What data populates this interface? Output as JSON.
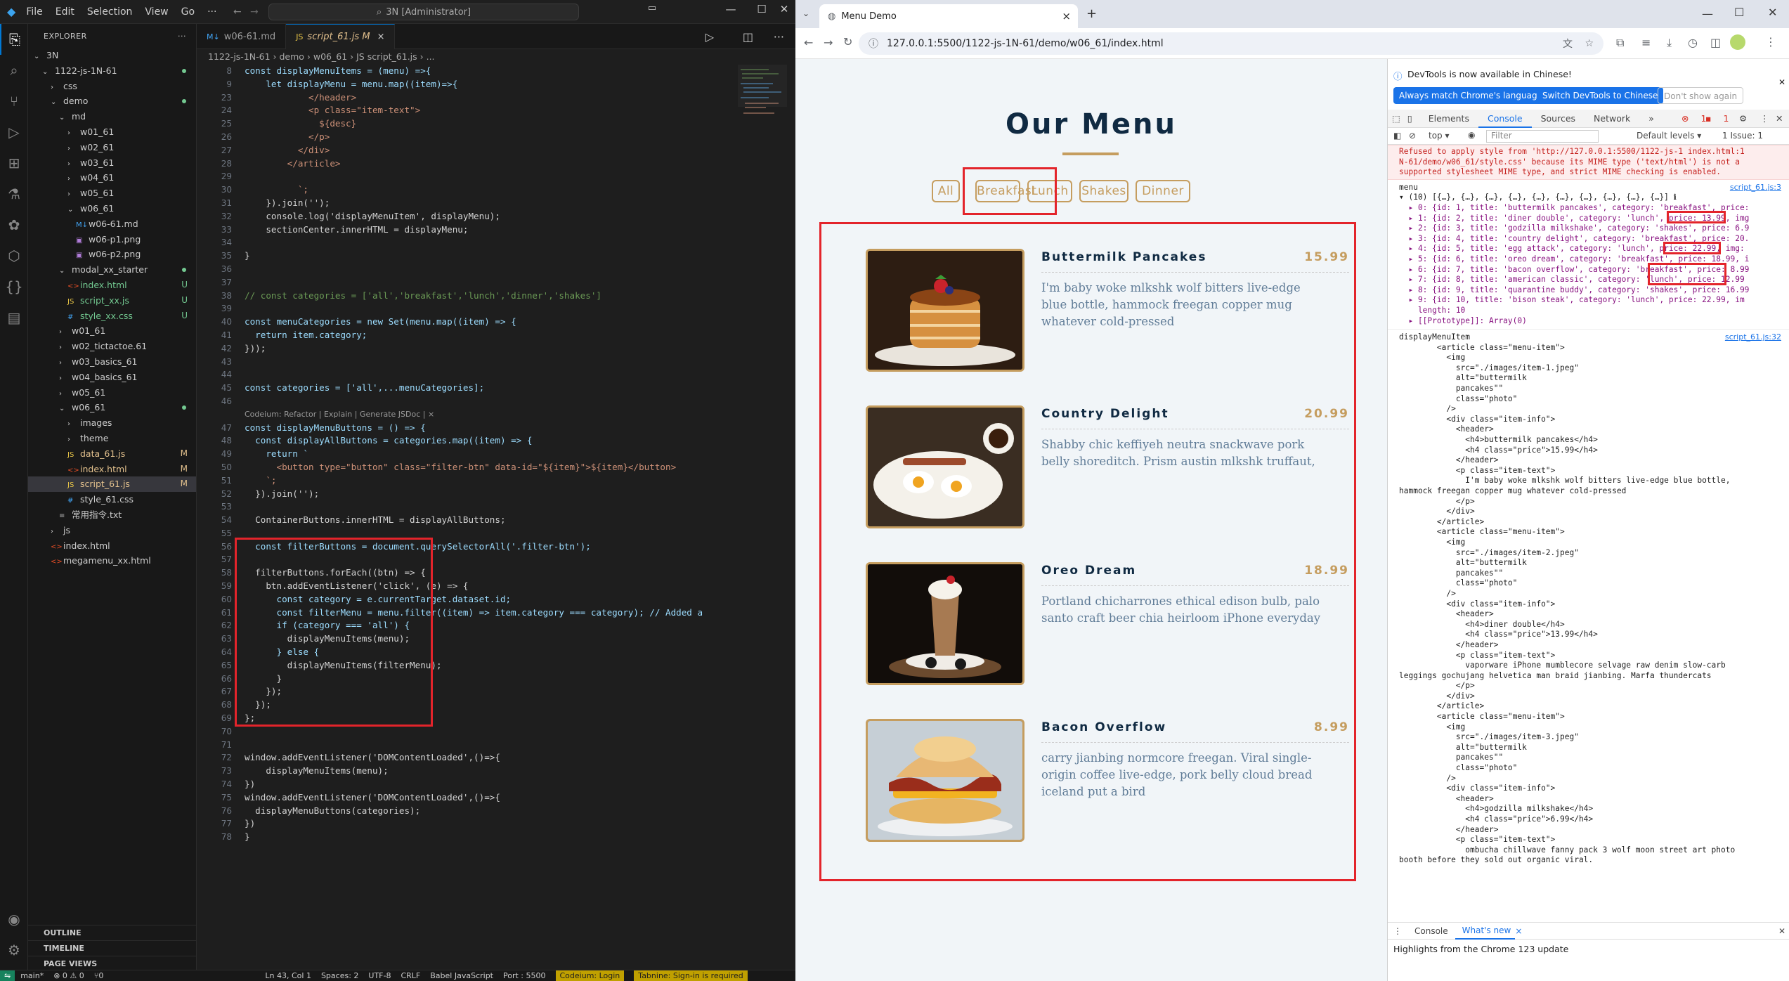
{
  "vscode": {
    "menus": [
      "File",
      "Edit",
      "Selection",
      "View",
      "Go",
      "···"
    ],
    "command_center": "3N [Administrator]",
    "explorer_title": "EXPLORER",
    "tree": [
      {
        "label": "3N",
        "indent": 0,
        "type": "folder-open",
        "status": ""
      },
      {
        "label": "1122-js-1N-61",
        "indent": 1,
        "type": "folder-open",
        "status": "dot"
      },
      {
        "label": "css",
        "indent": 2,
        "type": "folder",
        "status": ""
      },
      {
        "label": "demo",
        "indent": 2,
        "type": "folder-open",
        "status": "dot"
      },
      {
        "label": "md",
        "indent": 3,
        "type": "folder-open",
        "status": ""
      },
      {
        "label": "w01_61",
        "indent": 4,
        "type": "folder",
        "status": ""
      },
      {
        "label": "w02_61",
        "indent": 4,
        "type": "folder",
        "status": ""
      },
      {
        "label": "w03_61",
        "indent": 4,
        "type": "folder",
        "status": ""
      },
      {
        "label": "w04_61",
        "indent": 4,
        "type": "folder",
        "status": ""
      },
      {
        "label": "w05_61",
        "indent": 4,
        "type": "folder",
        "status": ""
      },
      {
        "label": "w06_61",
        "indent": 4,
        "type": "folder-open",
        "status": ""
      },
      {
        "label": "w06-61.md",
        "indent": 5,
        "type": "md",
        "status": ""
      },
      {
        "label": "w06-p1.png",
        "indent": 5,
        "type": "img",
        "status": ""
      },
      {
        "label": "w06-p2.png",
        "indent": 5,
        "type": "img",
        "status": ""
      },
      {
        "label": "modal_xx_starter",
        "indent": 3,
        "type": "folder-open",
        "status": "dot"
      },
      {
        "label": "index.html",
        "indent": 4,
        "type": "html",
        "status": "U"
      },
      {
        "label": "script_xx.js",
        "indent": 4,
        "type": "js",
        "status": "U"
      },
      {
        "label": "style_xx.css",
        "indent": 4,
        "type": "css",
        "status": "U"
      },
      {
        "label": "w01_61",
        "indent": 3,
        "type": "folder",
        "status": ""
      },
      {
        "label": "w02_tictactoe.61",
        "indent": 3,
        "type": "folder",
        "status": ""
      },
      {
        "label": "w03_basics_61",
        "indent": 3,
        "type": "folder",
        "status": ""
      },
      {
        "label": "w04_basics_61",
        "indent": 3,
        "type": "folder",
        "status": ""
      },
      {
        "label": "w05_61",
        "indent": 3,
        "type": "folder",
        "status": ""
      },
      {
        "label": "w06_61",
        "indent": 3,
        "type": "folder-open",
        "status": "dot"
      },
      {
        "label": "images",
        "indent": 4,
        "type": "folder",
        "status": ""
      },
      {
        "label": "theme",
        "indent": 4,
        "type": "folder",
        "status": ""
      },
      {
        "label": "data_61.js",
        "indent": 4,
        "type": "js",
        "status": "M"
      },
      {
        "label": "index.html",
        "indent": 4,
        "type": "html",
        "status": "M"
      },
      {
        "label": "script_61.js",
        "indent": 4,
        "type": "js",
        "status": "M",
        "selected": true
      },
      {
        "label": "style_61.css",
        "indent": 4,
        "type": "css",
        "status": ""
      },
      {
        "label": "常用指令.txt",
        "indent": 3,
        "type": "txt",
        "status": ""
      },
      {
        "label": "js",
        "indent": 2,
        "type": "folder",
        "status": ""
      },
      {
        "label": "index.html",
        "indent": 2,
        "type": "html",
        "status": ""
      },
      {
        "label": "megamenu_xx.html",
        "indent": 2,
        "type": "html",
        "status": ""
      }
    ],
    "sections": [
      "OUTLINE",
      "TIMELINE",
      "PAGE VIEWS"
    ],
    "tabs": [
      {
        "label": "w06-61.md",
        "icon": "M↓"
      },
      {
        "label": "script_61.js M",
        "icon": "JS"
      }
    ],
    "tab_close": "×",
    "breadcrumb": "1122-js-1N-61 › demo › w06_61 › JS script_61.js › ...",
    "code": [
      {
        "n": "8",
        "t": "const displayMenuItems = (menu) =>{"
      },
      {
        "n": "9",
        "t": "    let displayMenu = menu.map((item)=>{"
      },
      {
        "n": "23",
        "t": "            </header>"
      },
      {
        "n": "24",
        "t": "            <p class=\"item-text\">"
      },
      {
        "n": "25",
        "t": "              ${desc}"
      },
      {
        "n": "26",
        "t": "            </p>"
      },
      {
        "n": "27",
        "t": "          </div>"
      },
      {
        "n": "28",
        "t": "        </article>"
      },
      {
        "n": "29",
        "t": ""
      },
      {
        "n": "30",
        "t": "          `;"
      },
      {
        "n": "31",
        "t": "    }).join('');"
      },
      {
        "n": "32",
        "t": "    console.log('displayMenuItem', displayMenu);"
      },
      {
        "n": "33",
        "t": "    sectionCenter.innerHTML = displayMenu;"
      },
      {
        "n": "34",
        "t": ""
      },
      {
        "n": "35",
        "t": "}"
      },
      {
        "n": "36",
        "t": ""
      },
      {
        "n": "37",
        "t": ""
      },
      {
        "n": "38",
        "t": "// const categories = ['all','breakfast','lunch','dinner','shakes']"
      },
      {
        "n": "39",
        "t": ""
      },
      {
        "n": "40",
        "t": "const menuCategories = new Set(menu.map((item) => {"
      },
      {
        "n": "41",
        "t": "  return item.category;"
      },
      {
        "n": "42",
        "t": "}));"
      },
      {
        "n": "43",
        "t": ""
      },
      {
        "n": "44",
        "t": ""
      },
      {
        "n": "45",
        "t": "const categories = ['all',...menuCategories];"
      },
      {
        "n": "46",
        "t": ""
      },
      {
        "n": "",
        "t": "Codeium: Refactor | Explain | Generate JSDoc | ×",
        "lens": true
      },
      {
        "n": "47",
        "t": "const displayMenuButtons = () => {"
      },
      {
        "n": "48",
        "t": "  const displayAllButtons = categories.map((item) => {"
      },
      {
        "n": "49",
        "t": "    return `"
      },
      {
        "n": "50",
        "t": "      <button type=\"button\" class=\"filter-btn\" data-id=\"${item}\">${item}</button>"
      },
      {
        "n": "51",
        "t": "    `;"
      },
      {
        "n": "52",
        "t": "  }).join('');"
      },
      {
        "n": "53",
        "t": ""
      },
      {
        "n": "54",
        "t": "  ContainerButtons.innerHTML = displayAllButtons;"
      },
      {
        "n": "55",
        "t": ""
      },
      {
        "n": "56",
        "t": "  const filterButtons = document.querySelectorAll('.filter-btn');"
      },
      {
        "n": "57",
        "t": ""
      },
      {
        "n": "58",
        "t": "  filterButtons.forEach((btn) => {"
      },
      {
        "n": "59",
        "t": "    btn.addEventListener('click', (e) => {"
      },
      {
        "n": "60",
        "t": "      const category = e.currentTarget.dataset.id;"
      },
      {
        "n": "61",
        "t": "      const filterMenu = menu.filter((item) => item.category === category); // Added a"
      },
      {
        "n": "62",
        "t": "      if (category === 'all') {"
      },
      {
        "n": "63",
        "t": "        displayMenuItems(menu);"
      },
      {
        "n": "64",
        "t": "      } else {"
      },
      {
        "n": "65",
        "t": "        displayMenuItems(filterMenu);"
      },
      {
        "n": "66",
        "t": "      }"
      },
      {
        "n": "67",
        "t": "    });"
      },
      {
        "n": "68",
        "t": "  });"
      },
      {
        "n": "69",
        "t": "};"
      },
      {
        "n": "70",
        "t": ""
      },
      {
        "n": "71",
        "t": ""
      },
      {
        "n": "72",
        "t": "window.addEventListener('DOMContentLoaded',()=>{"
      },
      {
        "n": "73",
        "t": "    displayMenuItems(menu);"
      },
      {
        "n": "74",
        "t": "})"
      },
      {
        "n": "75",
        "t": "window.addEventListener('DOMContentLoaded',()=>{"
      },
      {
        "n": "76",
        "t": "  displayMenuButtons(categories);"
      },
      {
        "n": "77",
        "t": "})"
      },
      {
        "n": "78",
        "t": "}"
      }
    ],
    "status": {
      "branch": "main*",
      "sync": "⊗ 0 ⚠ 0",
      "ports": "⑂0",
      "pos": "Ln 43, Col 1",
      "spaces": "Spaces: 2",
      "enc": "UTF-8",
      "eol": "CRLF",
      "lang": "Babel JavaScript",
      "port": "Port : 5500",
      "codeium": "Codeium: Login",
      "tabnine": "Tabnine: Sign-in is required"
    }
  },
  "chrome": {
    "tab_title": "Menu Demo",
    "tab_close": "×",
    "new_tab": "+",
    "url": "127.0.0.1:5500/1122-js-1N-61/demo/w06_61/index.html",
    "page": {
      "title": "Our Menu",
      "filters": [
        "All",
        "Breakfast",
        "Lunch",
        "Shakes",
        "Dinner"
      ],
      "items": [
        {
          "name": "Buttermilk Pancakes",
          "price": "15.99",
          "desc": "I'm baby woke mlkshk wolf bitters live-edge blue bottle, hammock freegan copper mug whatever cold-pressed"
        },
        {
          "name": "Country Delight",
          "price": "20.99",
          "desc": "Shabby chic keffiyeh neutra snackwave pork belly shoreditch. Prism austin mlkshk truffaut,"
        },
        {
          "name": "Oreo Dream",
          "price": "18.99",
          "desc": "Portland chicharrones ethical edison bulb, palo santo craft beer chia heirloom iPhone everyday"
        },
        {
          "name": "Bacon Overflow",
          "price": "8.99",
          "desc": "carry jianbing normcore freegan. Viral single-origin coffee live-edge, pork belly cloud bread iceland put a bird"
        }
      ]
    },
    "devtools": {
      "banner": "DevTools is now available in Chinese!",
      "btn_match": "Always match Chrome's language",
      "btn_switch": "Switch DevTools to Chinese",
      "btn_dont": "Don't show again",
      "tabs": [
        "Elements",
        "Console",
        "Sources",
        "Network",
        "»"
      ],
      "err_count": "1",
      "msg_count": "1",
      "top": "top ▾",
      "filter": "Filter",
      "levels": "Default levels ▾",
      "issues": "1 Issue: 1",
      "error_lines": [
        "Refused to apply style from 'http://127.0.0.1:5500/1122-js-1 index.html:1",
        "N-61/demo/w06_61/style.css' because its MIME type ('text/html') is not a",
        "supported stylesheet MIME type, and strict MIME checking is enabled."
      ],
      "menu_label": "menu",
      "menu_src": "script_61.js:3",
      "menu_summary": "▾ (10) [{…}, {…}, {…}, {…}, {…}, {…}, {…}, {…}, {…}, {…}] ℹ",
      "menu_rows": [
        "  ▸ 0: {id: 1, title: 'buttermilk pancakes', category: 'breakfast', price:",
        "  ▸ 1: {id: 2, title: 'diner double', category: 'lunch', price: 13.99, img",
        "  ▸ 2: {id: 3, title: 'godzilla milkshake', category: 'shakes', price: 6.9",
        "  ▸ 3: {id: 4, title: 'country delight', category: 'breakfast', price: 20.",
        "  ▸ 4: {id: 5, title: 'egg attack', category: 'lunch', price: 22.99, img:",
        "  ▸ 5: {id: 6, title: 'oreo dream', category: 'breakfast', price: 18.99, i",
        "  ▸ 6: {id: 7, title: 'bacon overflow', category: 'breakfast', price: 8.99",
        "  ▸ 7: {id: 8, title: 'american classic', category: 'lunch', price: 12.99",
        "  ▸ 8: {id: 9, title: 'quarantine buddy', category: 'shakes', price: 16.99",
        "  ▸ 9: {id: 10, title: 'bison steak', category: 'lunch', price: 22.99, im",
        "    length: 10",
        "  ▸ [[Prototype]]: Array(0)"
      ],
      "dmi_label": "displayMenuItem",
      "dmi_src": "script_61.js:32",
      "dmi_lines": [
        "        <article class=\"menu-item\">",
        "          <img",
        "            src=\"./images/item-1.jpeg\"",
        "            alt=\"buttermilk",
        "            pancakes\"\"",
        "            class=\"photo\"",
        "          />",
        "          <div class=\"item-info\">",
        "            <header>",
        "              <h4>buttermilk pancakes</h4>",
        "              <h4 class=\"price\">15.99</h4>",
        "            </header>",
        "            <p class=\"item-text\">",
        "              I'm baby woke mlkshk wolf bitters live-edge blue bottle,",
        "hammock freegan copper mug whatever cold-pressed",
        "            </p>",
        "          </div>",
        "        </article>",
        "",
        "",
        "        <article class=\"menu-item\">",
        "          <img",
        "            src=\"./images/item-2.jpeg\"",
        "            alt=\"buttermilk",
        "            pancakes\"\"",
        "            class=\"photo\"",
        "          />",
        "          <div class=\"item-info\">",
        "            <header>",
        "              <h4>diner double</h4>",
        "              <h4 class=\"price\">13.99</h4>",
        "            </header>",
        "            <p class=\"item-text\">",
        "              vaporware iPhone mumblecore selvage raw denim slow-carb",
        "leggings gochujang helvetica man braid jianbing. Marfa thundercats",
        "            </p>",
        "          </div>",
        "        </article>",
        "",
        "",
        "        <article class=\"menu-item\">",
        "          <img",
        "            src=\"./images/item-3.jpeg\"",
        "            alt=\"buttermilk",
        "            pancakes\"\"",
        "            class=\"photo\"",
        "          />",
        "          <div class=\"item-info\">",
        "            <header>",
        "              <h4>godzilla milkshake</h4>",
        "              <h4 class=\"price\">6.99</h4>",
        "            </header>",
        "            <p class=\"item-text\">",
        "              ombucha chillwave fanny pack 3 wolf moon street art photo",
        "booth before they sold out organic viral."
      ],
      "drawer_tabs": [
        "Console",
        "What's new"
      ],
      "drawer_close": "×",
      "drawer_text": "Highlights from the Chrome 123 update"
    }
  }
}
